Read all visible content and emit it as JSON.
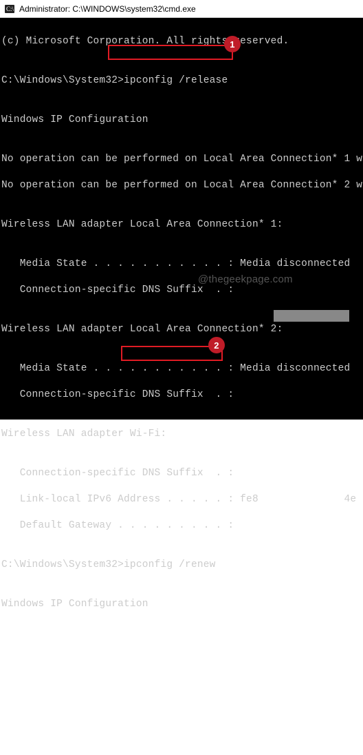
{
  "titlebar": {
    "title": "Administrator: C:\\WINDOWS\\system32\\cmd.exe"
  },
  "terminal": {
    "lines": {
      "copyright": "(c) Microsoft Corporation. All rights reserved.",
      "blank": "",
      "prompt1_prefix": "C:\\Windows\\System32>",
      "prompt1_cmd": "ipconfig /release",
      "heading1": "Windows IP Configuration",
      "noop1": "No operation can be performed on Local Area Connection* 1 w",
      "noop2": "No operation can be performed on Local Area Connection* 2 w",
      "adapter1_title": "Wireless LAN adapter Local Area Connection* 1:",
      "media_state1": "   Media State . . . . . . . . . . . : Media disconnected",
      "dns_suffix1": "   Connection-specific DNS Suffix  . :",
      "adapter2_title": "Wireless LAN adapter Local Area Connection* 2:",
      "media_state2": "   Media State . . . . . . . . . . . : Media disconnected",
      "dns_suffix2": "   Connection-specific DNS Suffix  . :",
      "adapter3_title": "Wireless LAN adapter Wi-Fi:",
      "dns_suffix3": "   Connection-specific DNS Suffix  . :",
      "ipv6": "   Link-local IPv6 Address . . . . . : fe8              4e",
      "gateway": "   Default Gateway . . . . . . . . . :",
      "prompt2_prefix": "C:\\Windows\\System32>",
      "prompt2_cmd": "ipconfig /renew",
      "heading2": "Windows IP Configuration"
    }
  },
  "callouts": {
    "one": "1",
    "two": "2"
  },
  "watermark": "@thegeekpage.com"
}
